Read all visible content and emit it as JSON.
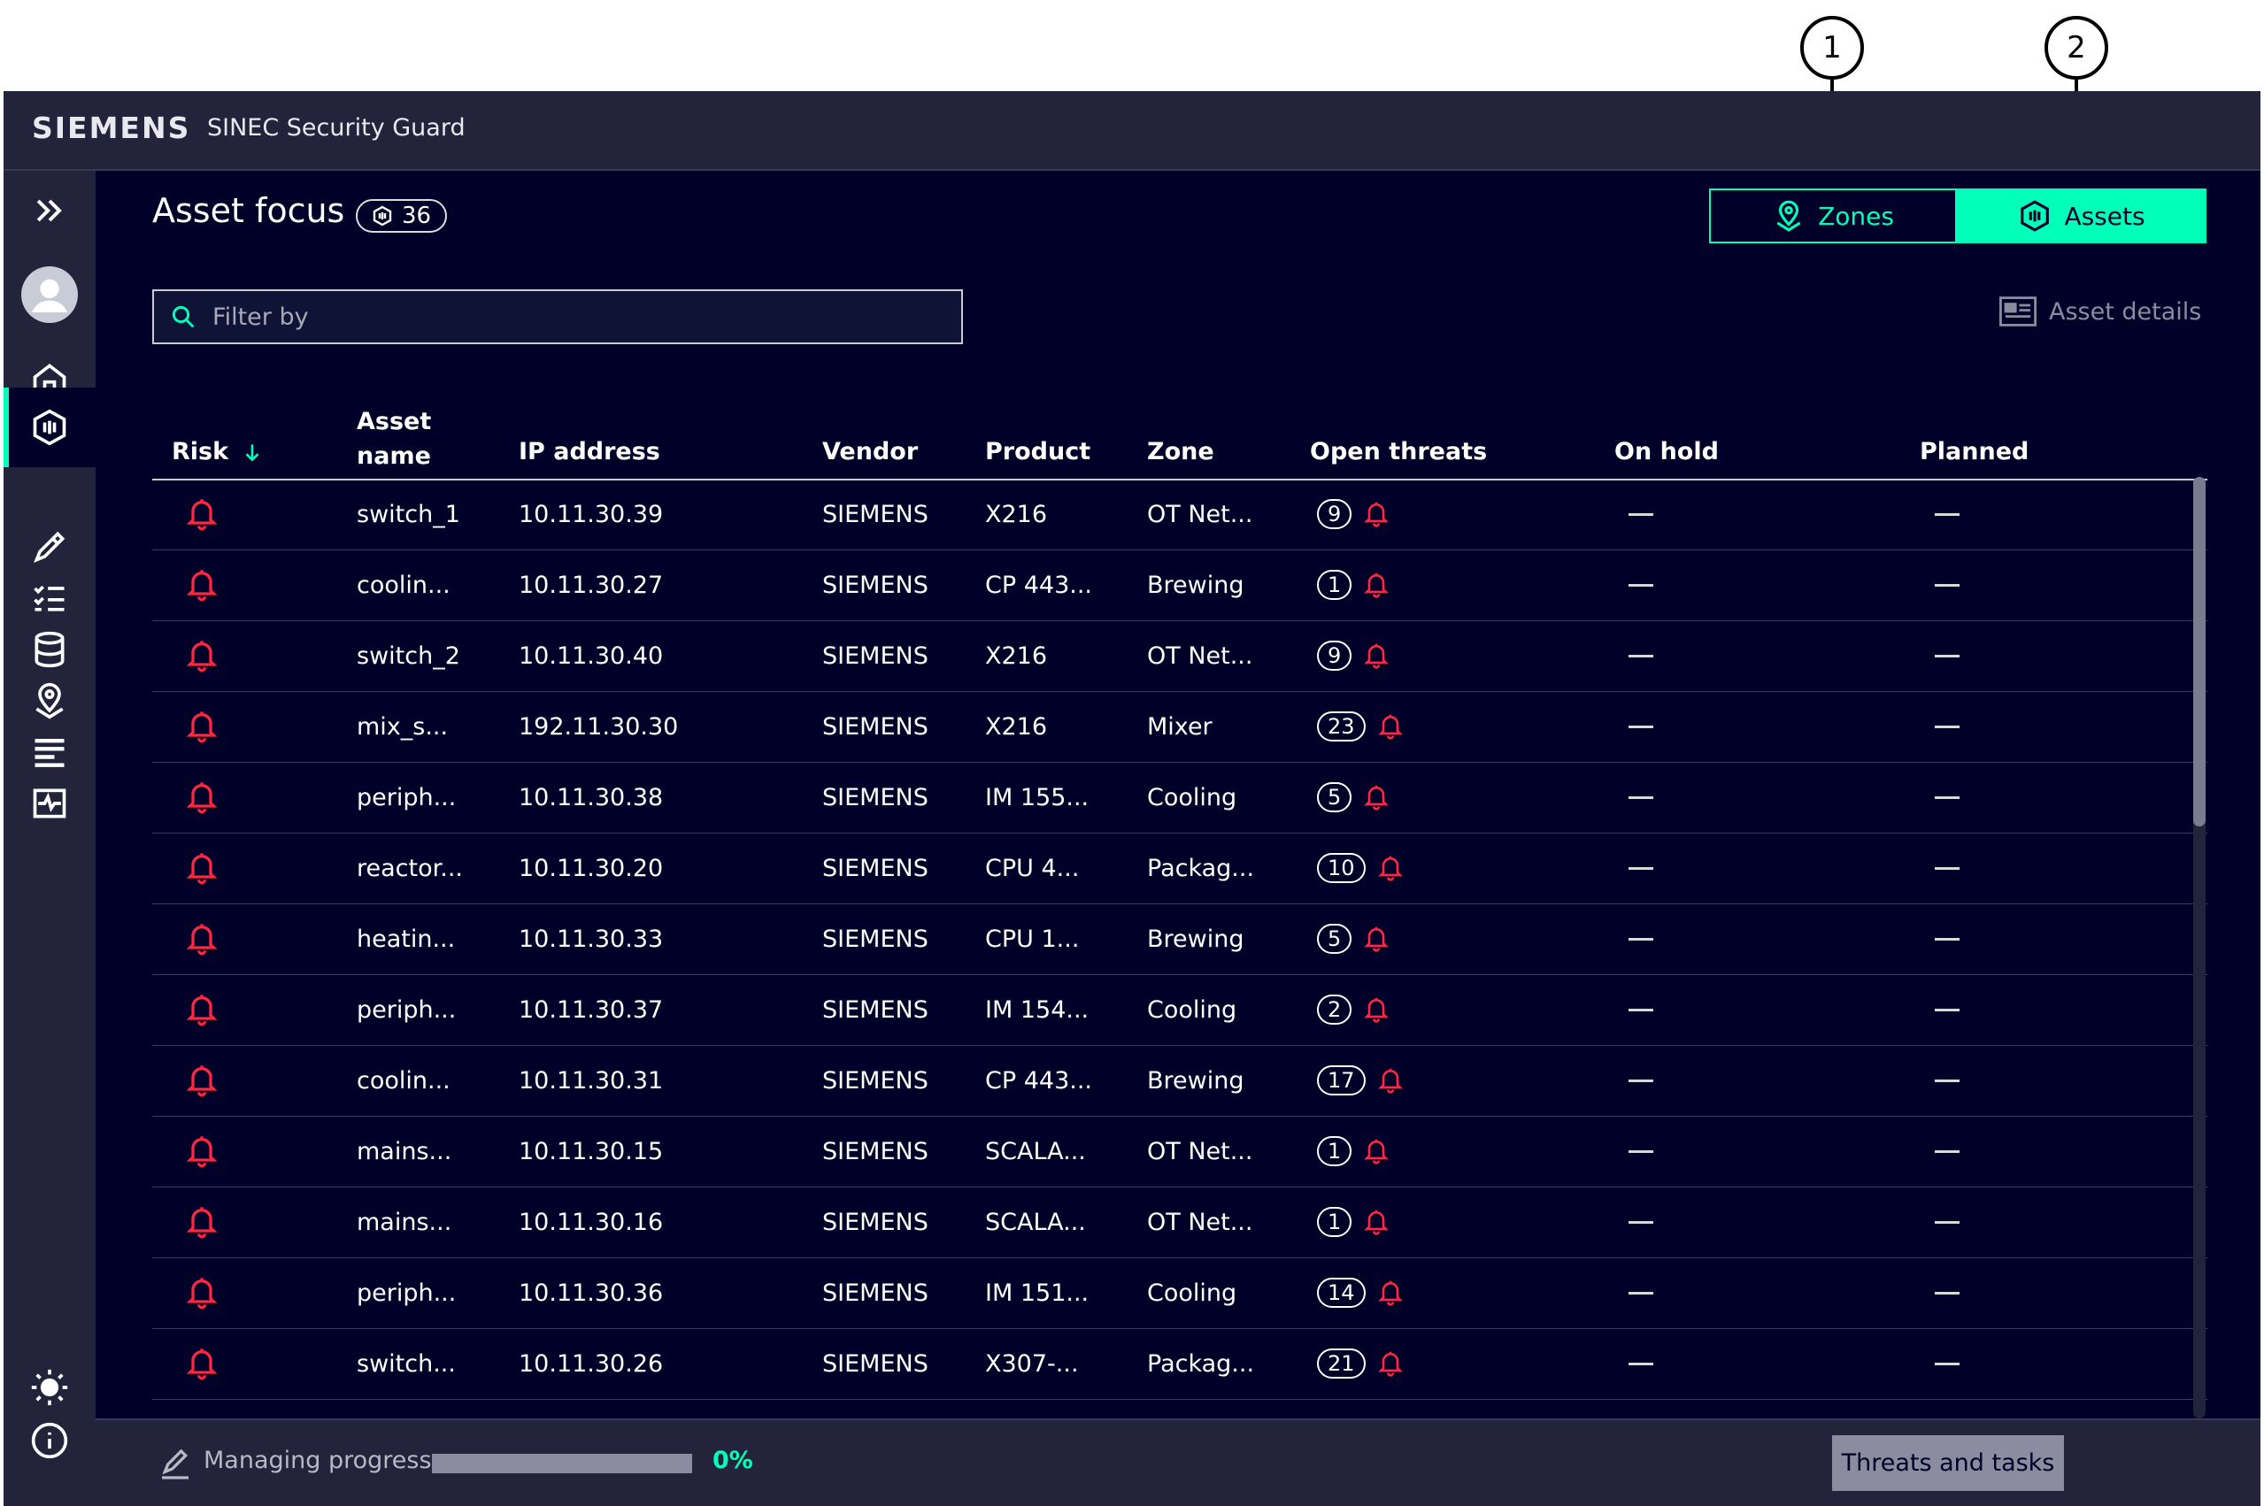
{
  "callouts": {
    "one": "1",
    "two": "2"
  },
  "header": {
    "brand": "SIEMENS",
    "app_title": "SINEC Security Guard"
  },
  "sidebar": {
    "items": [
      {
        "icon": "double-chevron-right-icon"
      },
      {
        "icon": "user-avatar-icon"
      },
      {
        "icon": "home-icon"
      },
      {
        "icon": "shield-threat-icon"
      },
      {
        "icon": "asset-icon",
        "active": true
      },
      {
        "icon": "pen-tool-icon"
      },
      {
        "icon": "checklist-icon"
      },
      {
        "icon": "database-icon"
      },
      {
        "icon": "zone-pin-icon"
      },
      {
        "icon": "list-icon"
      },
      {
        "icon": "monitor-icon"
      },
      {
        "icon": "theme-sun-icon"
      },
      {
        "icon": "info-icon"
      }
    ]
  },
  "page": {
    "title": "Asset focus",
    "count": "36"
  },
  "view_toggle": {
    "zones": "Zones",
    "assets": "Assets",
    "selected": "Assets"
  },
  "filter": {
    "placeholder": "Filter by"
  },
  "asset_details": "Asset details",
  "table": {
    "columns": {
      "risk": "Risk",
      "asset_name": "Asset name",
      "ip": "IP address",
      "vendor": "Vendor",
      "product": "Product",
      "zone": "Zone",
      "open_threats": "Open threats",
      "on_hold": "On hold",
      "planned": "Planned"
    },
    "sort": {
      "column": "Risk",
      "direction": "descending"
    },
    "rows": [
      {
        "name": "switch_1",
        "ip": "10.11.30.39",
        "vendor": "SIEMENS",
        "product": "X216",
        "zone": "OT Net...",
        "threats": "9"
      },
      {
        "name": "coolin...",
        "ip": "10.11.30.27",
        "vendor": "SIEMENS",
        "product": "CP 443...",
        "zone": "Brewing",
        "threats": "1"
      },
      {
        "name": "switch_2",
        "ip": "10.11.30.40",
        "vendor": "SIEMENS",
        "product": "X216",
        "zone": "OT Net...",
        "threats": "9"
      },
      {
        "name": "mix_s...",
        "ip": "192.11.30.30",
        "vendor": "SIEMENS",
        "product": "X216",
        "zone": "Mixer",
        "threats": "23"
      },
      {
        "name": "periph...",
        "ip": "10.11.30.38",
        "vendor": "SIEMENS",
        "product": "IM 155...",
        "zone": "Cooling",
        "threats": "5"
      },
      {
        "name": "reactor...",
        "ip": "10.11.30.20",
        "vendor": "SIEMENS",
        "product": "CPU 4...",
        "zone": "Packag...",
        "threats": "10"
      },
      {
        "name": "heatin...",
        "ip": "10.11.30.33",
        "vendor": "SIEMENS",
        "product": "CPU 1...",
        "zone": "Brewing",
        "threats": "5"
      },
      {
        "name": "periph...",
        "ip": "10.11.30.37",
        "vendor": "SIEMENS",
        "product": "IM 154...",
        "zone": "Cooling",
        "threats": "2"
      },
      {
        "name": "coolin...",
        "ip": "10.11.30.31",
        "vendor": "SIEMENS",
        "product": "CP 443...",
        "zone": "Brewing",
        "threats": "17"
      },
      {
        "name": "mains...",
        "ip": "10.11.30.15",
        "vendor": "SIEMENS",
        "product": "SCALA...",
        "zone": "OT Net...",
        "threats": "1"
      },
      {
        "name": "mains...",
        "ip": "10.11.30.16",
        "vendor": "SIEMENS",
        "product": "SCALA...",
        "zone": "OT Net...",
        "threats": "1"
      },
      {
        "name": "periph...",
        "ip": "10.11.30.36",
        "vendor": "SIEMENS",
        "product": "IM 151...",
        "zone": "Cooling",
        "threats": "14"
      },
      {
        "name": "switch...",
        "ip": "10.11.30.26",
        "vendor": "SIEMENS",
        "product": "X307-...",
        "zone": "Packag...",
        "threats": "21"
      }
    ]
  },
  "footer": {
    "progress_label": "Managing progress",
    "progress_value": 0,
    "progress_text": "0%",
    "button": "Threats and tasks"
  },
  "colors": {
    "background": "#000028",
    "panel": "#23233c",
    "accent": "#00ffb9",
    "alert": "#ff2640",
    "muted": "#8b8ca0"
  }
}
